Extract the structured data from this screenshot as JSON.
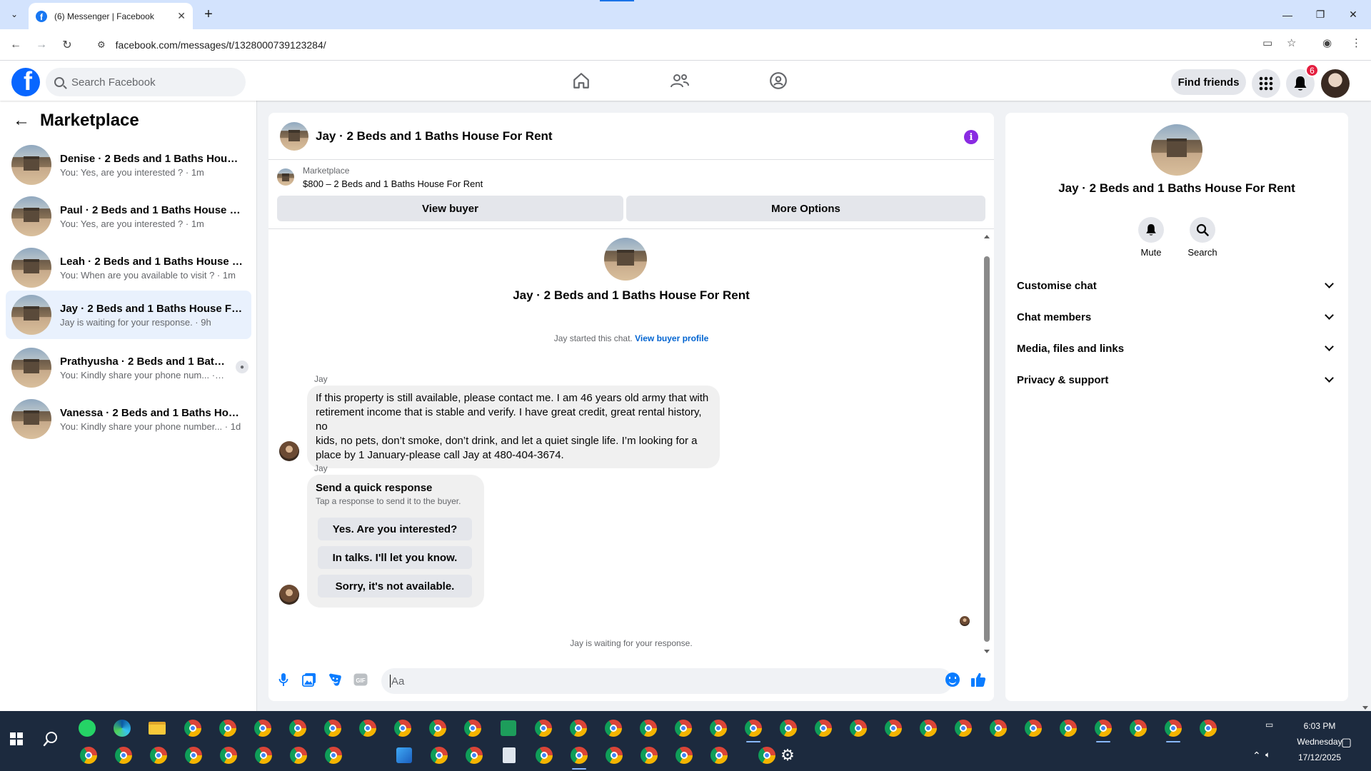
{
  "browser": {
    "tab_title": "(6) Messenger | Facebook",
    "url": "facebook.com/messages/t/1328000739123284/"
  },
  "fb": {
    "search_placeholder": "Search Facebook",
    "find_friends": "Find friends",
    "notification_count": "6",
    "brand_color": "#0866ff"
  },
  "sidebar": {
    "title": "Marketplace",
    "conversations": [
      {
        "name": "Denise · 2 Beds and 1 Baths House ...",
        "preview": "You: Yes, are you interested ? · 1m",
        "active": false
      },
      {
        "name": "Paul · 2 Beds and 1 Baths House Fo...",
        "preview": "You: Yes, are you interested ? · 1m",
        "active": false
      },
      {
        "name": "Leah · 2 Beds and 1 Baths House F...",
        "preview": "You: When are you available to visit ? · 1m",
        "active": false
      },
      {
        "name": "Jay · 2 Beds and 1 Baths House For...",
        "preview": "Jay is waiting for your response. · 9h",
        "active": true
      },
      {
        "name": "Prathyusha · 2 Beds and 1 Baths ...",
        "preview": "You: Kindly share your phone num... · 1d",
        "active": false
      },
      {
        "name": "Vanessa · 2 Beds and 1 Baths Hous...",
        "preview": "You: Kindly share your phone number... · 1d",
        "active": false
      }
    ]
  },
  "chat": {
    "title": "Jay · 2 Beds and 1 Baths House For Rent",
    "marketplace_label": "Marketplace",
    "listing": "$800 – 2 Beds and 1 Baths House For Rent",
    "view_buyer": "View buyer",
    "more_options": "More Options",
    "intro_title": "Jay · 2 Beds and 1 Baths House For Rent",
    "started_text": "Jay started this chat.",
    "view_buyer_profile": "View buyer profile",
    "sender": "Jay",
    "message_lines": [
      "If this property is still available, please contact me. I am 46 years old army that with",
      "retirement income that is stable and verify. I have great credit, great rental history, no",
      "kids, no pets, don’t smoke, don’t drink, and let a quiet single life. I’m looking for a",
      "place by 1 January-please call Jay at 480-404-3674."
    ],
    "quick_title": "Send a quick response",
    "quick_sub": "Tap a response to send it to the buyer.",
    "quick_replies": [
      "Yes. Are you interested?",
      "In talks. I'll let you know.",
      "Sorry, it's not available."
    ],
    "waiting": "Jay is waiting for your response.",
    "input_placeholder": "Aa",
    "accent": "#0a7cff"
  },
  "details": {
    "title": "Jay · 2 Beds and 1 Baths House For Rent",
    "mute": "Mute",
    "search": "Search",
    "sections": [
      "Customise chat",
      "Chat members",
      "Media, files and links",
      "Privacy & support"
    ]
  },
  "taskbar": {
    "time": "6:03 PM",
    "day": "Wednesday",
    "date": "17/12/2025"
  }
}
